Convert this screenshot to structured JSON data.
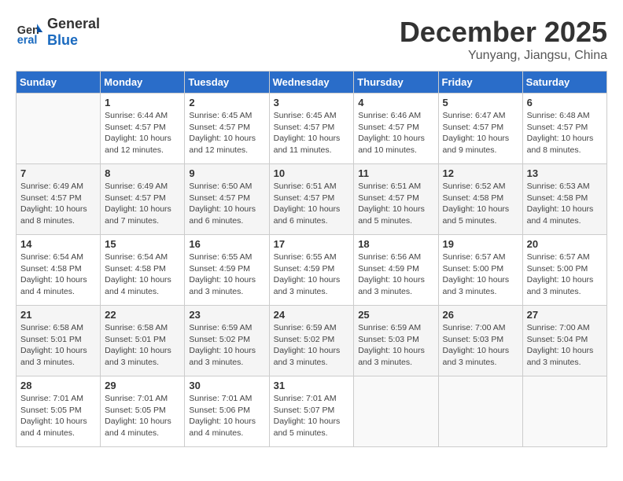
{
  "header": {
    "logo_general": "General",
    "logo_blue": "Blue",
    "month_title": "December 2025",
    "location": "Yunyang, Jiangsu, China"
  },
  "days_of_week": [
    "Sunday",
    "Monday",
    "Tuesday",
    "Wednesday",
    "Thursday",
    "Friday",
    "Saturday"
  ],
  "weeks": [
    [
      {
        "day": "",
        "detail": ""
      },
      {
        "day": "1",
        "detail": "Sunrise: 6:44 AM\nSunset: 4:57 PM\nDaylight: 10 hours\nand 12 minutes."
      },
      {
        "day": "2",
        "detail": "Sunrise: 6:45 AM\nSunset: 4:57 PM\nDaylight: 10 hours\nand 12 minutes."
      },
      {
        "day": "3",
        "detail": "Sunrise: 6:45 AM\nSunset: 4:57 PM\nDaylight: 10 hours\nand 11 minutes."
      },
      {
        "day": "4",
        "detail": "Sunrise: 6:46 AM\nSunset: 4:57 PM\nDaylight: 10 hours\nand 10 minutes."
      },
      {
        "day": "5",
        "detail": "Sunrise: 6:47 AM\nSunset: 4:57 PM\nDaylight: 10 hours\nand 9 minutes."
      },
      {
        "day": "6",
        "detail": "Sunrise: 6:48 AM\nSunset: 4:57 PM\nDaylight: 10 hours\nand 8 minutes."
      }
    ],
    [
      {
        "day": "7",
        "detail": "Sunrise: 6:49 AM\nSunset: 4:57 PM\nDaylight: 10 hours\nand 8 minutes."
      },
      {
        "day": "8",
        "detail": "Sunrise: 6:49 AM\nSunset: 4:57 PM\nDaylight: 10 hours\nand 7 minutes."
      },
      {
        "day": "9",
        "detail": "Sunrise: 6:50 AM\nSunset: 4:57 PM\nDaylight: 10 hours\nand 6 minutes."
      },
      {
        "day": "10",
        "detail": "Sunrise: 6:51 AM\nSunset: 4:57 PM\nDaylight: 10 hours\nand 6 minutes."
      },
      {
        "day": "11",
        "detail": "Sunrise: 6:51 AM\nSunset: 4:57 PM\nDaylight: 10 hours\nand 5 minutes."
      },
      {
        "day": "12",
        "detail": "Sunrise: 6:52 AM\nSunset: 4:58 PM\nDaylight: 10 hours\nand 5 minutes."
      },
      {
        "day": "13",
        "detail": "Sunrise: 6:53 AM\nSunset: 4:58 PM\nDaylight: 10 hours\nand 4 minutes."
      }
    ],
    [
      {
        "day": "14",
        "detail": "Sunrise: 6:54 AM\nSunset: 4:58 PM\nDaylight: 10 hours\nand 4 minutes."
      },
      {
        "day": "15",
        "detail": "Sunrise: 6:54 AM\nSunset: 4:58 PM\nDaylight: 10 hours\nand 4 minutes."
      },
      {
        "day": "16",
        "detail": "Sunrise: 6:55 AM\nSunset: 4:59 PM\nDaylight: 10 hours\nand 3 minutes."
      },
      {
        "day": "17",
        "detail": "Sunrise: 6:55 AM\nSunset: 4:59 PM\nDaylight: 10 hours\nand 3 minutes."
      },
      {
        "day": "18",
        "detail": "Sunrise: 6:56 AM\nSunset: 4:59 PM\nDaylight: 10 hours\nand 3 minutes."
      },
      {
        "day": "19",
        "detail": "Sunrise: 6:57 AM\nSunset: 5:00 PM\nDaylight: 10 hours\nand 3 minutes."
      },
      {
        "day": "20",
        "detail": "Sunrise: 6:57 AM\nSunset: 5:00 PM\nDaylight: 10 hours\nand 3 minutes."
      }
    ],
    [
      {
        "day": "21",
        "detail": "Sunrise: 6:58 AM\nSunset: 5:01 PM\nDaylight: 10 hours\nand 3 minutes."
      },
      {
        "day": "22",
        "detail": "Sunrise: 6:58 AM\nSunset: 5:01 PM\nDaylight: 10 hours\nand 3 minutes."
      },
      {
        "day": "23",
        "detail": "Sunrise: 6:59 AM\nSunset: 5:02 PM\nDaylight: 10 hours\nand 3 minutes."
      },
      {
        "day": "24",
        "detail": "Sunrise: 6:59 AM\nSunset: 5:02 PM\nDaylight: 10 hours\nand 3 minutes."
      },
      {
        "day": "25",
        "detail": "Sunrise: 6:59 AM\nSunset: 5:03 PM\nDaylight: 10 hours\nand 3 minutes."
      },
      {
        "day": "26",
        "detail": "Sunrise: 7:00 AM\nSunset: 5:03 PM\nDaylight: 10 hours\nand 3 minutes."
      },
      {
        "day": "27",
        "detail": "Sunrise: 7:00 AM\nSunset: 5:04 PM\nDaylight: 10 hours\nand 3 minutes."
      }
    ],
    [
      {
        "day": "28",
        "detail": "Sunrise: 7:01 AM\nSunset: 5:05 PM\nDaylight: 10 hours\nand 4 minutes."
      },
      {
        "day": "29",
        "detail": "Sunrise: 7:01 AM\nSunset: 5:05 PM\nDaylight: 10 hours\nand 4 minutes."
      },
      {
        "day": "30",
        "detail": "Sunrise: 7:01 AM\nSunset: 5:06 PM\nDaylight: 10 hours\nand 4 minutes."
      },
      {
        "day": "31",
        "detail": "Sunrise: 7:01 AM\nSunset: 5:07 PM\nDaylight: 10 hours\nand 5 minutes."
      },
      {
        "day": "",
        "detail": ""
      },
      {
        "day": "",
        "detail": ""
      },
      {
        "day": "",
        "detail": ""
      }
    ]
  ]
}
